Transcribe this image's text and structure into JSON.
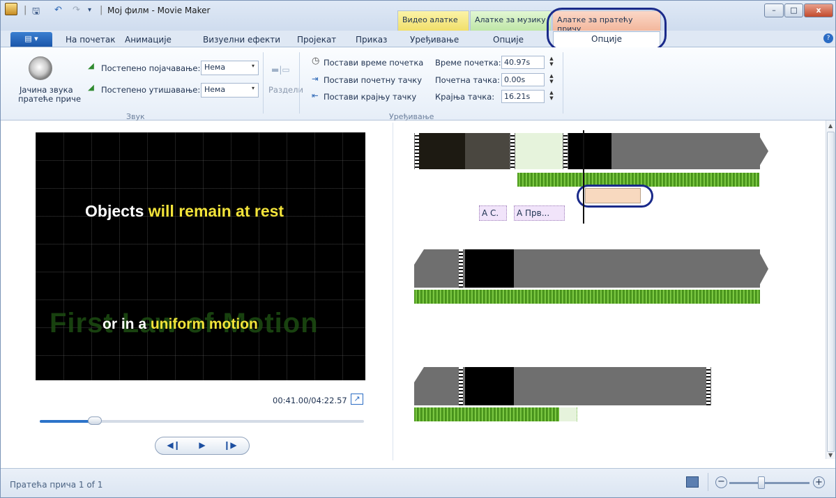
{
  "window": {
    "title": "Мој филм - Movie Maker",
    "quick_access": [
      "save-icon",
      "undo-icon",
      "redo-icon",
      "customize-icon"
    ],
    "context_tabs": {
      "video": "Видео алатке",
      "music": "Алатке за музику",
      "narration": "Алатке за пратећу причу"
    },
    "controls": {
      "minimize": "–",
      "maximize": "□",
      "close": "x"
    }
  },
  "tabs": {
    "file": "▤ ▾",
    "items": [
      "На почетак",
      "Анимације",
      "Визуелни ефекти",
      "Пројекат",
      "Приказ",
      "Уређивање",
      "Опције"
    ],
    "active": "Опције",
    "help": "?"
  },
  "ribbon": {
    "audio": {
      "volume_label_1": "Јачина звука",
      "volume_label_2": "пратеће приче",
      "fade_in_label": "Постепено појачавање:",
      "fade_in_value": "Нема",
      "fade_out_label": "Постепено утишавање:",
      "fade_out_value": "Нема",
      "group": "Звук"
    },
    "editing": {
      "split": "Раздели",
      "set_start_time": "Постави време почетка",
      "set_start_point": "Постави почетну тачку",
      "set_end_point": "Постави крајњу тачку",
      "start_time_label": "Време почетка:",
      "start_time_value": "40.97s",
      "start_point_label": "Почетна тачка:",
      "start_point_value": "0.00s",
      "end_point_label": "Крајња тачка:",
      "end_point_value": "16.21s",
      "group": "Уређивање"
    }
  },
  "preview": {
    "caption_line1_white": "Objects",
    "caption_line1_yellow": "will remain at rest",
    "caption_line2_white": "or in a",
    "caption_line2_yellow": "uniform motion",
    "background_title": "First Law of Motion",
    "time": "00:41.00/04:22.57",
    "seek_progress": 0.17,
    "buttons": {
      "prev": "◀❙",
      "play": "▶",
      "next": "❙▶"
    }
  },
  "storyboard": {
    "caption_items": [
      "A C.",
      "A Прв..."
    ]
  },
  "status": {
    "text": "Пратећа прича 1 of 1",
    "zoom_level": 0.4
  },
  "colors": {
    "ribbon_bg": "#e6eef8",
    "accent": "#1b56a9",
    "narration_tab": "#f6c7b2",
    "video_tab": "#f6e98a",
    "music_tab": "#cfeec0",
    "annotation": "#1a2a8a"
  }
}
